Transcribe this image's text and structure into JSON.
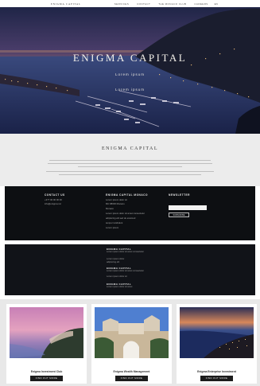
{
  "nav": {
    "logo": "ENIGMA CAPITAL",
    "links": [
      "SERVICES",
      "CONTACT",
      "THE MONACO CLUB",
      "CAREERS"
    ],
    "lang": "EN"
  },
  "hero": {
    "title": "ENIGMA CAPITAL",
    "subtitle_1": "Lorem ipsum",
    "subtitle_2": "Lorem ipsum"
  },
  "about": {
    "title": "ENIGMA CAPITAL"
  },
  "info": {
    "col1_heading": "CONTACT US",
    "col1_lines": [
      "+377 00 00 00 00",
      "info@enigma.mc"
    ],
    "col2_heading": "ENIGMA CAPITAL MONACO",
    "col2_lines": [
      "Lorem ipsum dolor sit",
      "MC 98000 Monaco",
      "Monaco",
      "",
      "Lorem ipsum dolor sit amet consectetur",
      "adipiscing elit sed do eiusmod",
      "tempor incididunt",
      "Lorem ipsum"
    ],
    "col3_heading": "NEWSLETTER",
    "subscribe_label": "SUBSCRIBE"
  },
  "locations": [
    {
      "heading": "ENIGMA CAPITAL",
      "lines": [
        "Lorem ipsum dolor sit amet consectetur",
        "",
        "Lorem ipsum dolor",
        "adipiscing elit"
      ]
    },
    {
      "heading": "ENIGMA CAPITAL",
      "lines": [
        "Lorem ipsum dolor sit amet consectetur",
        "",
        "Lorem ipsum dolor sit"
      ]
    },
    {
      "heading": "ENIGMA CAPITAL",
      "lines": [
        "Lorem ipsum dolor sit amet"
      ]
    }
  ],
  "cards": [
    {
      "name": "Enigma Investment Club",
      "cta": "FIND OUT MORE"
    },
    {
      "name": "Enigma Wealth Management",
      "cta": "FIND OUT MORE"
    },
    {
      "name": "Enigma Enterprise Investment",
      "cta": "FIND OUT MORE"
    }
  ]
}
